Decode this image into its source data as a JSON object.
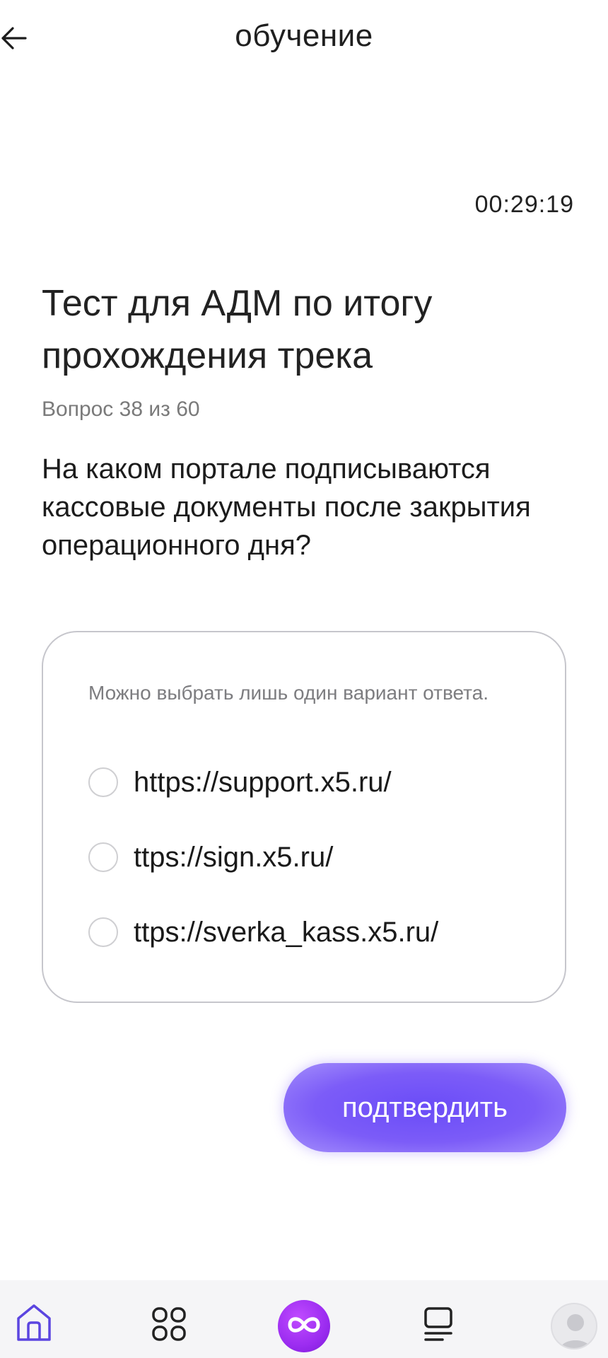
{
  "header": {
    "title": "обучение",
    "back_icon": "arrow-left-icon"
  },
  "timer": "00:29:19",
  "test": {
    "title": "Тест для АДМ по итогу прохождения трека",
    "counter": "Вопрос 38 из 60",
    "question": "На каком портале подписываются кассовые документы после закрытия операционного дня?"
  },
  "answers": {
    "hint": "Можно выбрать лишь один вариант ответа.",
    "options": [
      {
        "label": "https://support.x5.ru/",
        "selected": false
      },
      {
        "label": "ttps://sign.x5.ru/",
        "selected": false
      },
      {
        "label": "ttps://sverka_kass.x5.ru/",
        "selected": false
      }
    ]
  },
  "confirm_label": "подтвердить",
  "bottom_nav": {
    "items": [
      "home-icon",
      "apps-grid-icon",
      "infinity-icon",
      "list-icon",
      "profile-avatar"
    ],
    "active": "home-icon"
  },
  "colors": {
    "accent": "#7c5cf8",
    "nav_active": "#5b45e0",
    "center_badge": "#9b2cf0",
    "card_border": "#c6c6cc",
    "muted_text": "#7a7a7a"
  }
}
